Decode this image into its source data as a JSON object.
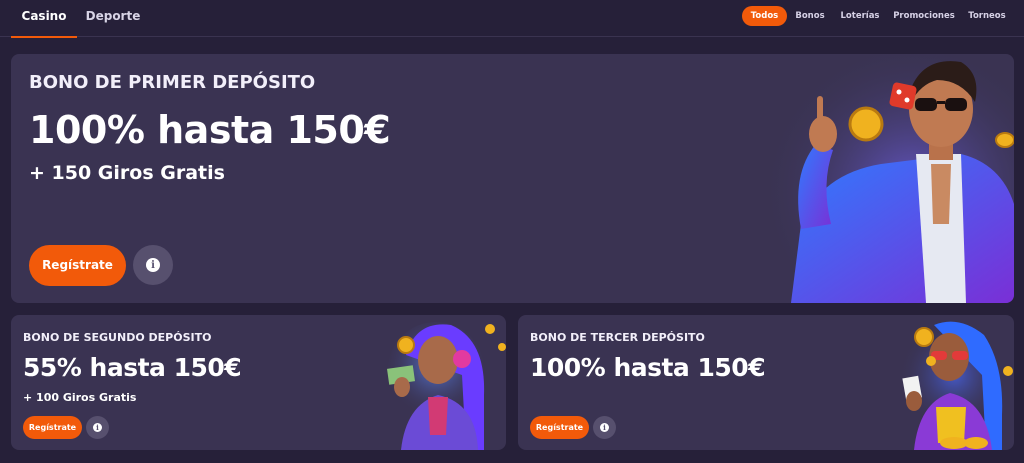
{
  "top_nav": {
    "tabs": [
      {
        "label": "Casino",
        "active": true
      },
      {
        "label": "Deporte",
        "active": false
      }
    ],
    "filters": [
      {
        "label": "Todos",
        "active": true
      },
      {
        "label": "Bonos",
        "active": false
      },
      {
        "label": "Loterías",
        "active": false
      },
      {
        "label": "Promociones",
        "active": false
      },
      {
        "label": "Torneos",
        "active": false
      }
    ]
  },
  "promos": {
    "first": {
      "label": "BONO DE PRIMER DEPÓSITO",
      "headline": "100% hasta 150€",
      "sub": "+ 150 Giros Gratis",
      "cta": "Regístrate",
      "illustration": "man-in-suit-with-coin-and-dice"
    },
    "second": {
      "label": "BONO DE SEGUNDO DEPÓSITO",
      "headline": "55% hasta 150€",
      "sub": "+ 100 Giros Gratis",
      "cta": "Regístrate",
      "illustration": "woman-with-headphones-holding-cash"
    },
    "third": {
      "label": "BONO DE TERCER DEPÓSITO",
      "headline": "100% hasta 150€",
      "cta": "Regístrate",
      "illustration": "woman-with-sunglasses-holding-card"
    }
  },
  "colors": {
    "background": "#262039",
    "card": "#3a3352",
    "accent": "#f25a0a"
  },
  "icons": {
    "info": "info-icon"
  }
}
